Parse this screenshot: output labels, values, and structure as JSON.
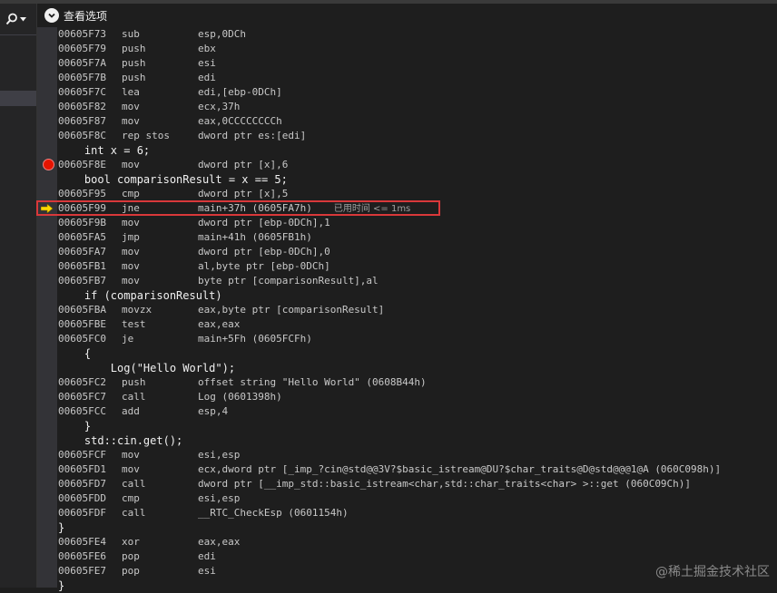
{
  "header": {
    "view_options_label": "查看选项",
    "view_options_icon": "chevron-down-icon",
    "search_icon": "search-icon"
  },
  "lines": [
    {
      "type": "asm",
      "addr": "00605F73",
      "mn": "sub",
      "ops": "esp,0DCh"
    },
    {
      "type": "asm",
      "addr": "00605F79",
      "mn": "push",
      "ops": "ebx"
    },
    {
      "type": "asm",
      "addr": "00605F7A",
      "mn": "push",
      "ops": "esi"
    },
    {
      "type": "asm",
      "addr": "00605F7B",
      "mn": "push",
      "ops": "edi"
    },
    {
      "type": "asm",
      "addr": "00605F7C",
      "mn": "lea",
      "ops": "edi,[ebp-0DCh]"
    },
    {
      "type": "asm",
      "addr": "00605F82",
      "mn": "mov",
      "ops": "ecx,37h"
    },
    {
      "type": "asm",
      "addr": "00605F87",
      "mn": "mov",
      "ops": "eax,0CCCCCCCCh"
    },
    {
      "type": "asm",
      "addr": "00605F8C",
      "mn": "rep stos",
      "ops": "dword ptr es:[edi]"
    },
    {
      "type": "src",
      "text": "    int x = 6;"
    },
    {
      "type": "asm",
      "addr": "00605F8E",
      "mn": "mov",
      "ops": "dword ptr [x],6",
      "breakpoint": true
    },
    {
      "type": "src",
      "text": "    bool comparisonResult = x == 5;"
    },
    {
      "type": "asm",
      "addr": "00605F95",
      "mn": "cmp",
      "ops": "dword ptr [x],5"
    },
    {
      "type": "asm",
      "addr": "00605F99",
      "mn": "jne",
      "ops": "main+37h (0605FA7h)",
      "current": true,
      "elapsed": "已用时间 <= 1ms"
    },
    {
      "type": "asm",
      "addr": "00605F9B",
      "mn": "mov",
      "ops": "dword ptr [ebp-0DCh],1"
    },
    {
      "type": "asm",
      "addr": "00605FA5",
      "mn": "jmp",
      "ops": "main+41h (0605FB1h)"
    },
    {
      "type": "asm",
      "addr": "00605FA7",
      "mn": "mov",
      "ops": "dword ptr [ebp-0DCh],0"
    },
    {
      "type": "asm",
      "addr": "00605FB1",
      "mn": "mov",
      "ops": "al,byte ptr [ebp-0DCh]"
    },
    {
      "type": "asm",
      "addr": "00605FB7",
      "mn": "mov",
      "ops": "byte ptr [comparisonResult],al"
    },
    {
      "type": "src",
      "text": "    if (comparisonResult)"
    },
    {
      "type": "asm",
      "addr": "00605FBA",
      "mn": "movzx",
      "ops": "eax,byte ptr [comparisonResult]"
    },
    {
      "type": "asm",
      "addr": "00605FBE",
      "mn": "test",
      "ops": "eax,eax"
    },
    {
      "type": "asm",
      "addr": "00605FC0",
      "mn": "je",
      "ops": "main+5Fh (0605FCFh)"
    },
    {
      "type": "src",
      "text": "    {"
    },
    {
      "type": "src",
      "text": "        Log(\"Hello World\");"
    },
    {
      "type": "asm",
      "addr": "00605FC2",
      "mn": "push",
      "ops": "offset string \"Hello World\" (0608B44h)"
    },
    {
      "type": "asm",
      "addr": "00605FC7",
      "mn": "call",
      "ops": "Log (0601398h)"
    },
    {
      "type": "asm",
      "addr": "00605FCC",
      "mn": "add",
      "ops": "esp,4"
    },
    {
      "type": "src",
      "text": "    }"
    },
    {
      "type": "src",
      "text": "    std::cin.get();"
    },
    {
      "type": "asm",
      "addr": "00605FCF",
      "mn": "mov",
      "ops": "esi,esp"
    },
    {
      "type": "asm",
      "addr": "00605FD1",
      "mn": "mov",
      "ops": "ecx,dword ptr [_imp_?cin@std@@3V?$basic_istream@DU?$char_traits@D@std@@@1@A (060C098h)]"
    },
    {
      "type": "asm",
      "addr": "00605FD7",
      "mn": "call",
      "ops": "dword ptr [__imp_std::basic_istream<char,std::char_traits<char> >::get (060C09Ch)]"
    },
    {
      "type": "asm",
      "addr": "00605FDD",
      "mn": "cmp",
      "ops": "esi,esp"
    },
    {
      "type": "asm",
      "addr": "00605FDF",
      "mn": "call",
      "ops": "__RTC_CheckEsp (0601154h)"
    },
    {
      "type": "src",
      "text": "}"
    },
    {
      "type": "asm",
      "addr": "00605FE4",
      "mn": "xor",
      "ops": "eax,eax"
    },
    {
      "type": "asm",
      "addr": "00605FE6",
      "mn": "pop",
      "ops": "edi"
    },
    {
      "type": "asm",
      "addr": "00605FE7",
      "mn": "pop",
      "ops": "esi"
    },
    {
      "type": "src",
      "text": "}"
    }
  ],
  "watermark": "@稀土掘金技术社区",
  "colors": {
    "background": "#1e1e1e",
    "breakpoint": "#e51400",
    "current_arrow": "#ffd800",
    "highlight_box": "#d9383a"
  }
}
